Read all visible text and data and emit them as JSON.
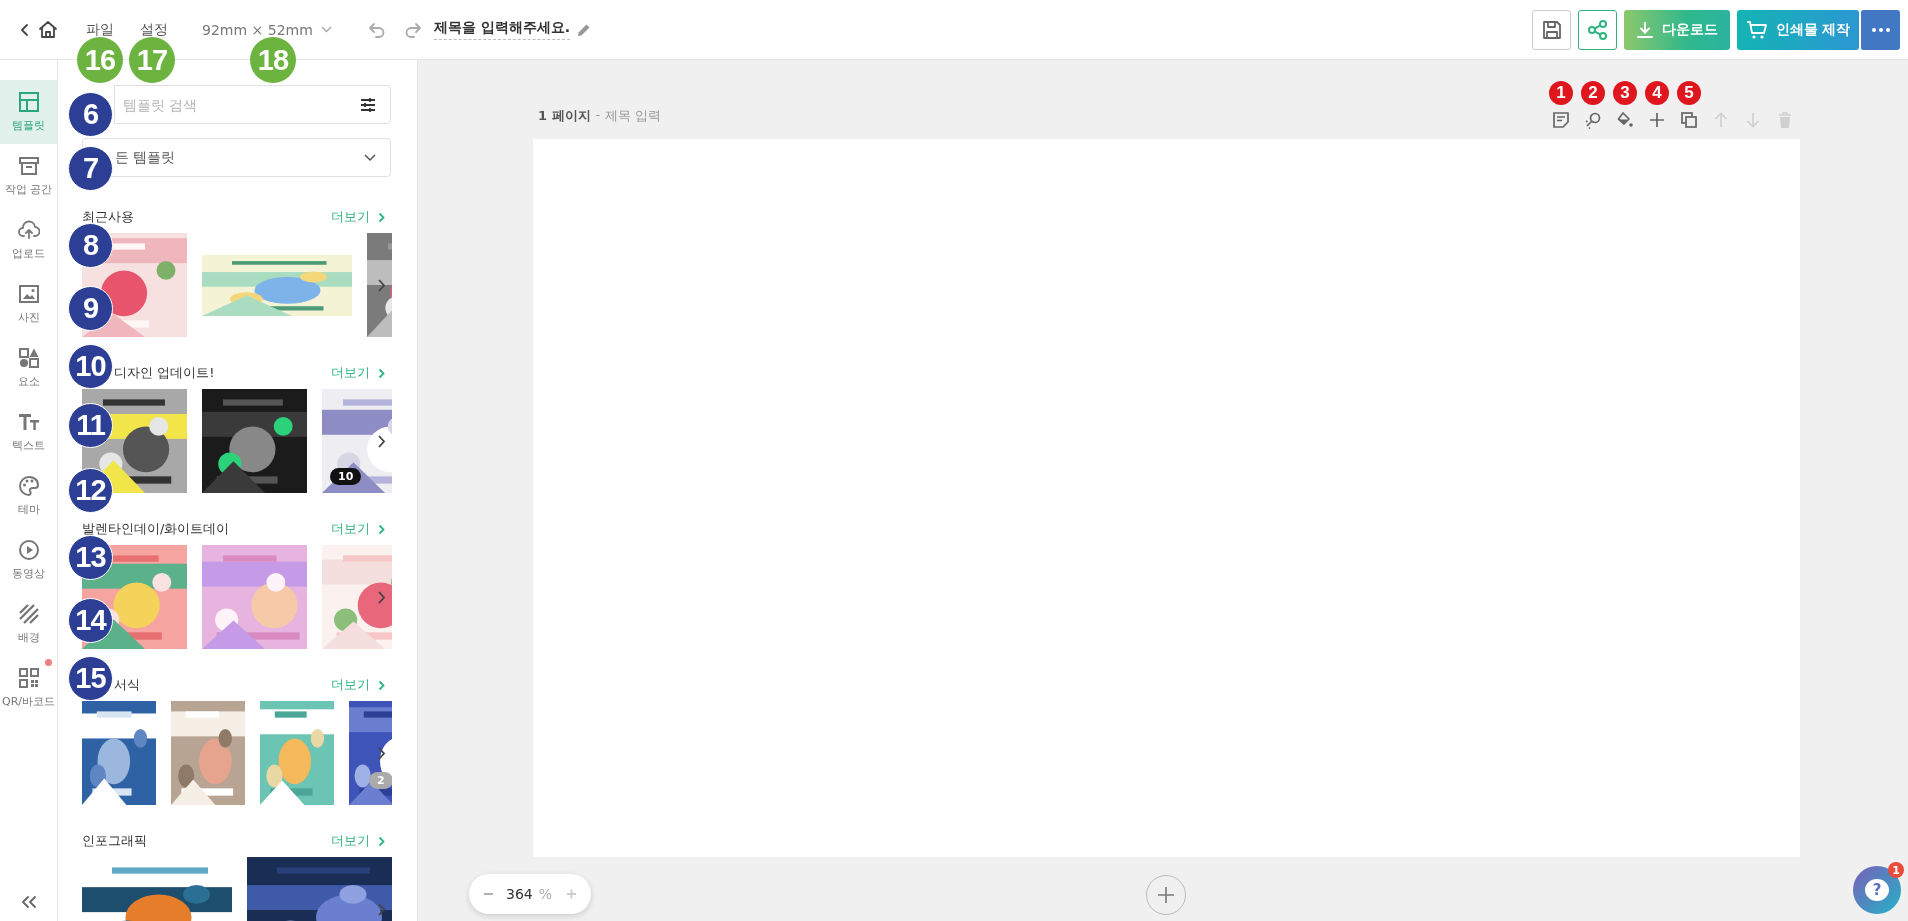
{
  "top_bar": {
    "menu": [
      {
        "label": "파일",
        "callout": "16"
      },
      {
        "label": "설정",
        "callout": "17"
      }
    ],
    "size": {
      "label": "92mm × 52mm",
      "callout": "18"
    },
    "title": "제목을 입력해주세요.",
    "actions": [
      {
        "label": "다운로드"
      },
      {
        "label": "인쇄물 제작"
      }
    ]
  },
  "rail": {
    "items": [
      {
        "label": "템플릿",
        "selected": true,
        "notice": false
      },
      {
        "label": "작업 공간",
        "selected": false,
        "notice": false
      },
      {
        "label": "업로드",
        "selected": false,
        "notice": false
      },
      {
        "label": "사진",
        "selected": false,
        "notice": false
      },
      {
        "label": "요소",
        "selected": false,
        "notice": false
      },
      {
        "label": "텍스트",
        "selected": false,
        "notice": false
      },
      {
        "label": "테마",
        "selected": false,
        "notice": false
      },
      {
        "label": "동영상",
        "selected": false,
        "notice": false
      },
      {
        "label": "배경",
        "selected": false,
        "notice": false
      },
      {
        "label": "QR/바코드",
        "selected": false,
        "notice": true
      }
    ]
  },
  "panel": {
    "search": {
      "placeholder": "템플릿 검색",
      "callout": "6"
    },
    "category": {
      "value": "든 템플릿",
      "callout": "7"
    },
    "sections": [
      {
        "title": "최근사용",
        "more": "더보기",
        "callouts": [
          "8",
          "9"
        ],
        "thumbs": [
          {
            "kind": "picture"
          },
          {
            "kind": "picture"
          },
          {
            "kind": "picture"
          }
        ]
      },
      {
        "title": "디자인 업데이트!",
        "title_callout": "10",
        "more": "더보기",
        "callouts": [
          "11",
          "12"
        ],
        "thumbs": [
          {
            "kind": "picture"
          },
          {
            "kind": "picture"
          },
          {
            "kind": "picture",
            "badge": "10"
          }
        ]
      },
      {
        "title": "발렌타인데이/화이트데이",
        "more": "더보기",
        "callouts": [
          "13",
          "14"
        ],
        "thumbs": [
          {
            "kind": "picture"
          },
          {
            "kind": "picture"
          },
          {
            "kind": "picture"
          }
        ]
      },
      {
        "title": "서식",
        "title_callout": "15",
        "more": "더보기",
        "thumbs": [
          {
            "kind": "picture"
          },
          {
            "kind": "picture"
          },
          {
            "kind": "picture"
          },
          {
            "kind": "picture",
            "badge": "2"
          }
        ]
      },
      {
        "title": "인포그래픽",
        "more": "더보기",
        "thumbs": [
          {
            "kind": "picture"
          },
          {
            "kind": "picture"
          }
        ]
      }
    ]
  },
  "canvas": {
    "page_number": "1 페이지",
    "separator": "-",
    "page_title": "제목 입력",
    "tools": [
      {
        "disabled": false,
        "callout": "1"
      },
      {
        "disabled": false,
        "callout": "2"
      },
      {
        "disabled": false,
        "callout": "3"
      },
      {
        "disabled": false,
        "callout": "4"
      },
      {
        "disabled": false,
        "callout": "5"
      },
      {
        "disabled": true
      },
      {
        "disabled": true
      },
      {
        "disabled": true
      }
    ],
    "zoom": {
      "value": "364",
      "unit": "%"
    }
  },
  "help": {
    "glyph": "?",
    "badge": "1"
  }
}
